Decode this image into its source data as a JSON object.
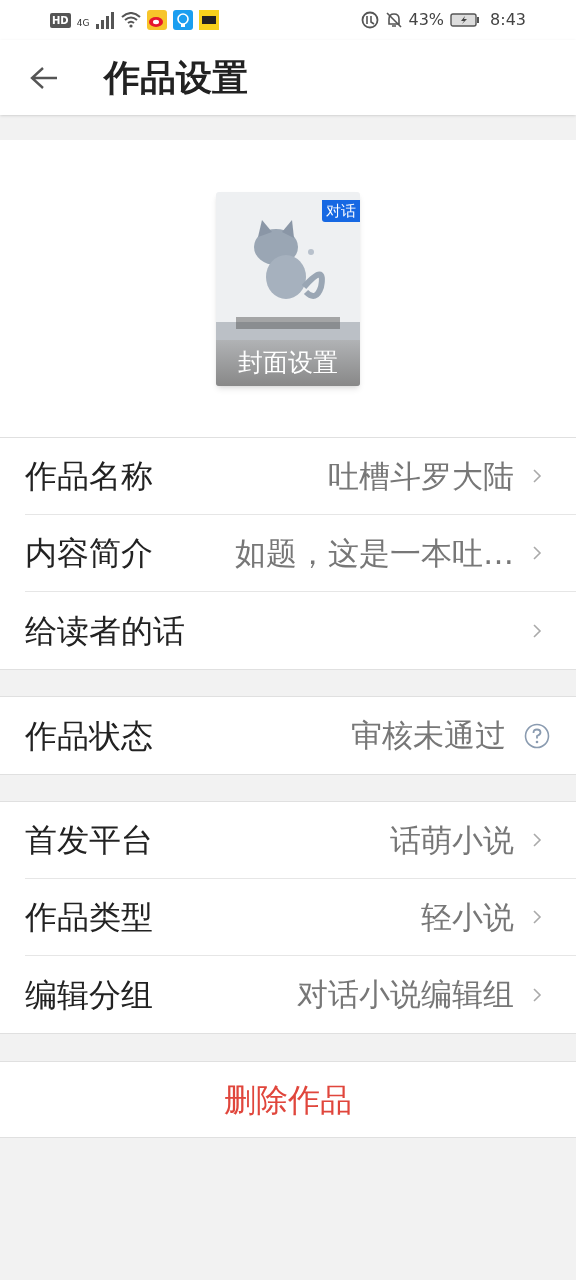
{
  "status_bar": {
    "hd": "HD",
    "network": "4G",
    "battery": "43%",
    "time": "8:43"
  },
  "header": {
    "title": "作品设置"
  },
  "cover": {
    "badge": "对话",
    "button": "封面设置"
  },
  "sections": [
    {
      "rows": [
        {
          "kind": "link",
          "label": "作品名称",
          "value": "吐槽斗罗大陆"
        },
        {
          "kind": "link",
          "label": "内容简介",
          "value": "如题，这是一本吐…"
        },
        {
          "kind": "link",
          "label": "给读者的话"
        }
      ]
    },
    {
      "rows": [
        {
          "kind": "help",
          "label": "作品状态",
          "value": "审核未通过"
        }
      ]
    },
    {
      "rows": [
        {
          "kind": "link",
          "label": "首发平台",
          "value": "话萌小说"
        },
        {
          "kind": "link",
          "label": "作品类型",
          "value": "轻小说"
        },
        {
          "kind": "link",
          "label": "编辑分组",
          "value": "对话小说编辑组"
        }
      ]
    }
  ],
  "delete_button": "删除作品"
}
